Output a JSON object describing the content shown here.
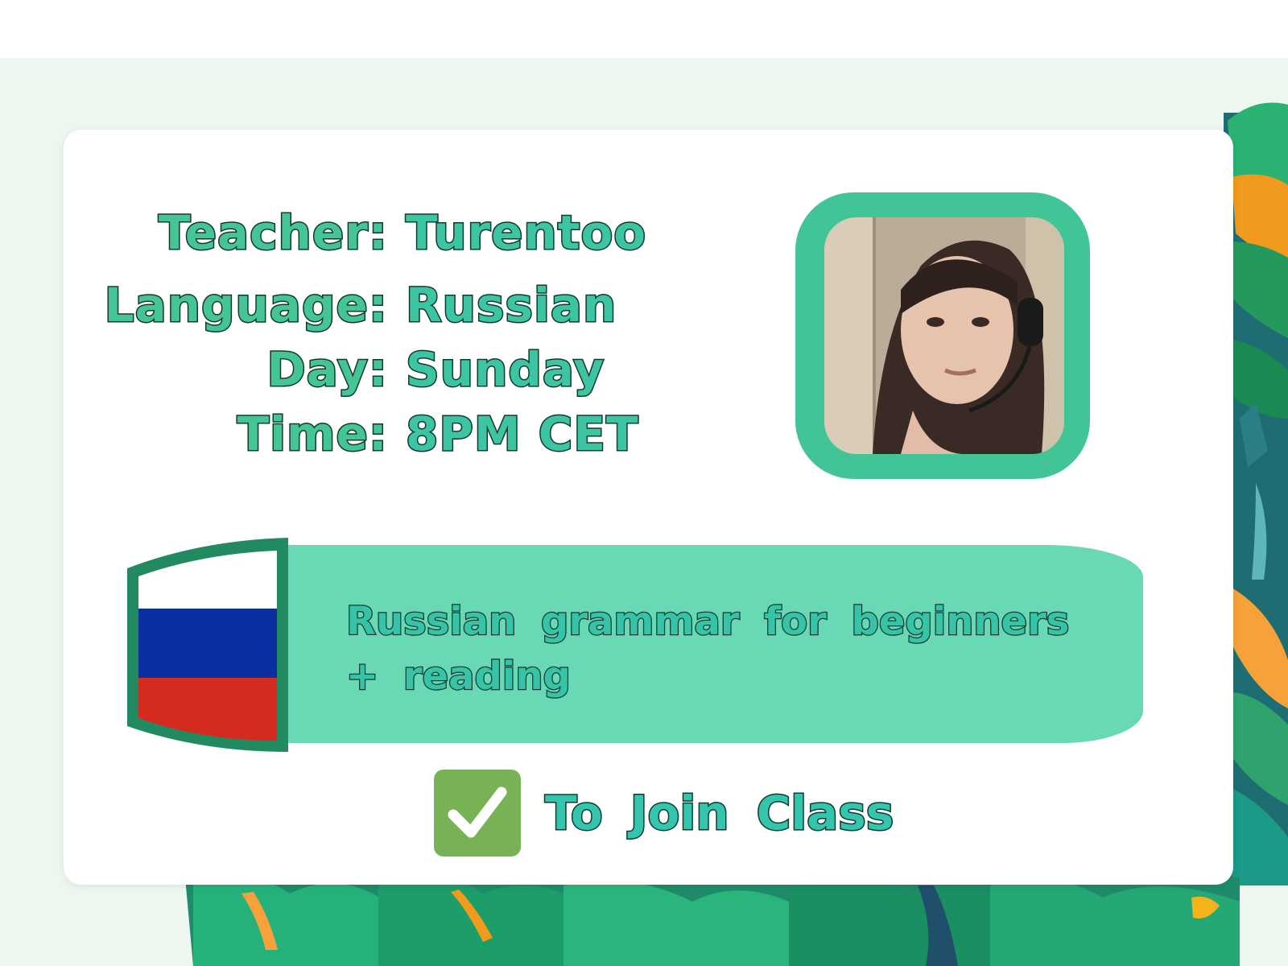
{
  "class_card": {
    "rows": [
      {
        "label": "Teacher:",
        "value": "Turentoo"
      },
      {
        "label": "Language:",
        "value": "Russian"
      },
      {
        "label": "Day:",
        "value": "Sunday"
      },
      {
        "label": "Time:",
        "value": "8PM CET"
      }
    ],
    "description_line1": "Russian grammar for beginners",
    "description_line2": "+ reading",
    "join_label": "To Join Class",
    "flag_colors": {
      "top": "#ffffff",
      "middle": "#0b2fa1",
      "bottom": "#d52b1e"
    },
    "check_icon": "white-check-mark-icon"
  },
  "colors": {
    "background": "#edf7f0",
    "accent_green": "#42c596",
    "banner": "#68d8b5",
    "text_outline": "#0f3b2c",
    "check_bg": "#77b255"
  }
}
